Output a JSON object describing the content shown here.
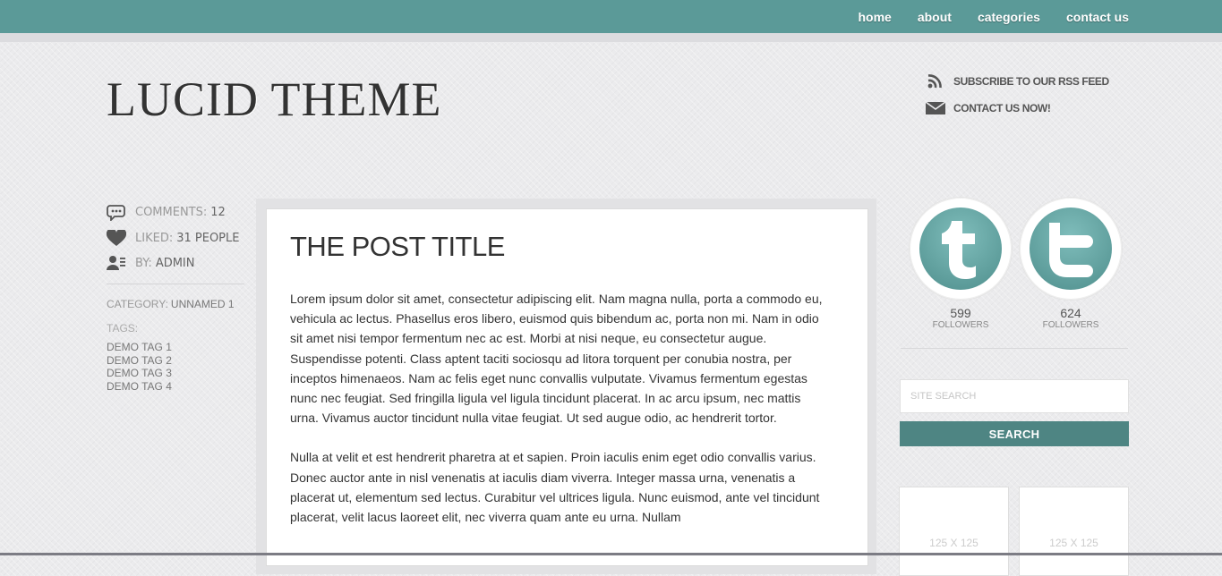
{
  "nav": {
    "items": [
      "home",
      "about",
      "categories",
      "contact us"
    ]
  },
  "header": {
    "logo": "LUCID THEME",
    "rss_label": "SUBSCRIBE TO OUR RSS FEED",
    "contact_label": "CONTACT US NOW!"
  },
  "meta": {
    "comments_label": "COMMENTS:",
    "comments_value": "12",
    "liked_label": "LIKED:",
    "liked_value": "31 PEOPLE",
    "by_label": "BY:",
    "by_value": "ADMIN",
    "category_label": "CATEGORY:",
    "category_value": "UNNAMED 1",
    "tags_label": "TAGS:",
    "tags": [
      "DEMO TAG 1",
      "DEMO TAG 2",
      "DEMO TAG 3",
      "DEMO TAG 4"
    ]
  },
  "post": {
    "title": "THE POST TITLE",
    "paragraphs": [
      "Lorem ipsum dolor sit amet, consectetur adipiscing elit. Nam magna nulla, porta a commodo eu, vehicula ac lectus. Phasellus eros libero, euismod quis bibendum ac, porta non mi. Nam in odio sit amet nisi tempor fermentum nec ac est. Morbi at nisi neque, eu consectetur augue. Suspendisse potenti. Class aptent taciti sociosqu ad litora torquent per conubia nostra, per inceptos himenaeos. Nam ac felis eget nunc convallis vulputate. Vivamus fermentum egestas nunc nec feugiat. Sed fringilla ligula vel ligula tincidunt placerat. In ac arcu ipsum, nec mattis urna. Vivamus auctor tincidunt nulla vitae feugiat. Ut sed augue odio, ac hendrerit tortor.",
      "Nulla at velit et est hendrerit pharetra at et sapien. Proin iaculis enim eget odio convallis varius. Donec auctor ante in nisl venenatis at iaculis diam viverra. Integer massa urna, venenatis a placerat ut, elementum sed lectus. Curabitur vel ultrices ligula. Nunc euismod, ante vel tincidunt placerat, velit lacus laoreet elit, nec viverra quam ante eu urna. Nullam"
    ]
  },
  "sidebar": {
    "social": [
      {
        "icon": "tumblr-icon",
        "count": "599",
        "label": "FOLLOWERS"
      },
      {
        "icon": "twitter-icon",
        "count": "624",
        "label": "FOLLOWERS"
      }
    ],
    "search_placeholder": "SITE SEARCH",
    "search_button": "SEARCH",
    "ads": [
      "125 X 125",
      "125 X 125"
    ]
  },
  "colors": {
    "accent": "#5b9a98",
    "button": "#4e8583"
  }
}
